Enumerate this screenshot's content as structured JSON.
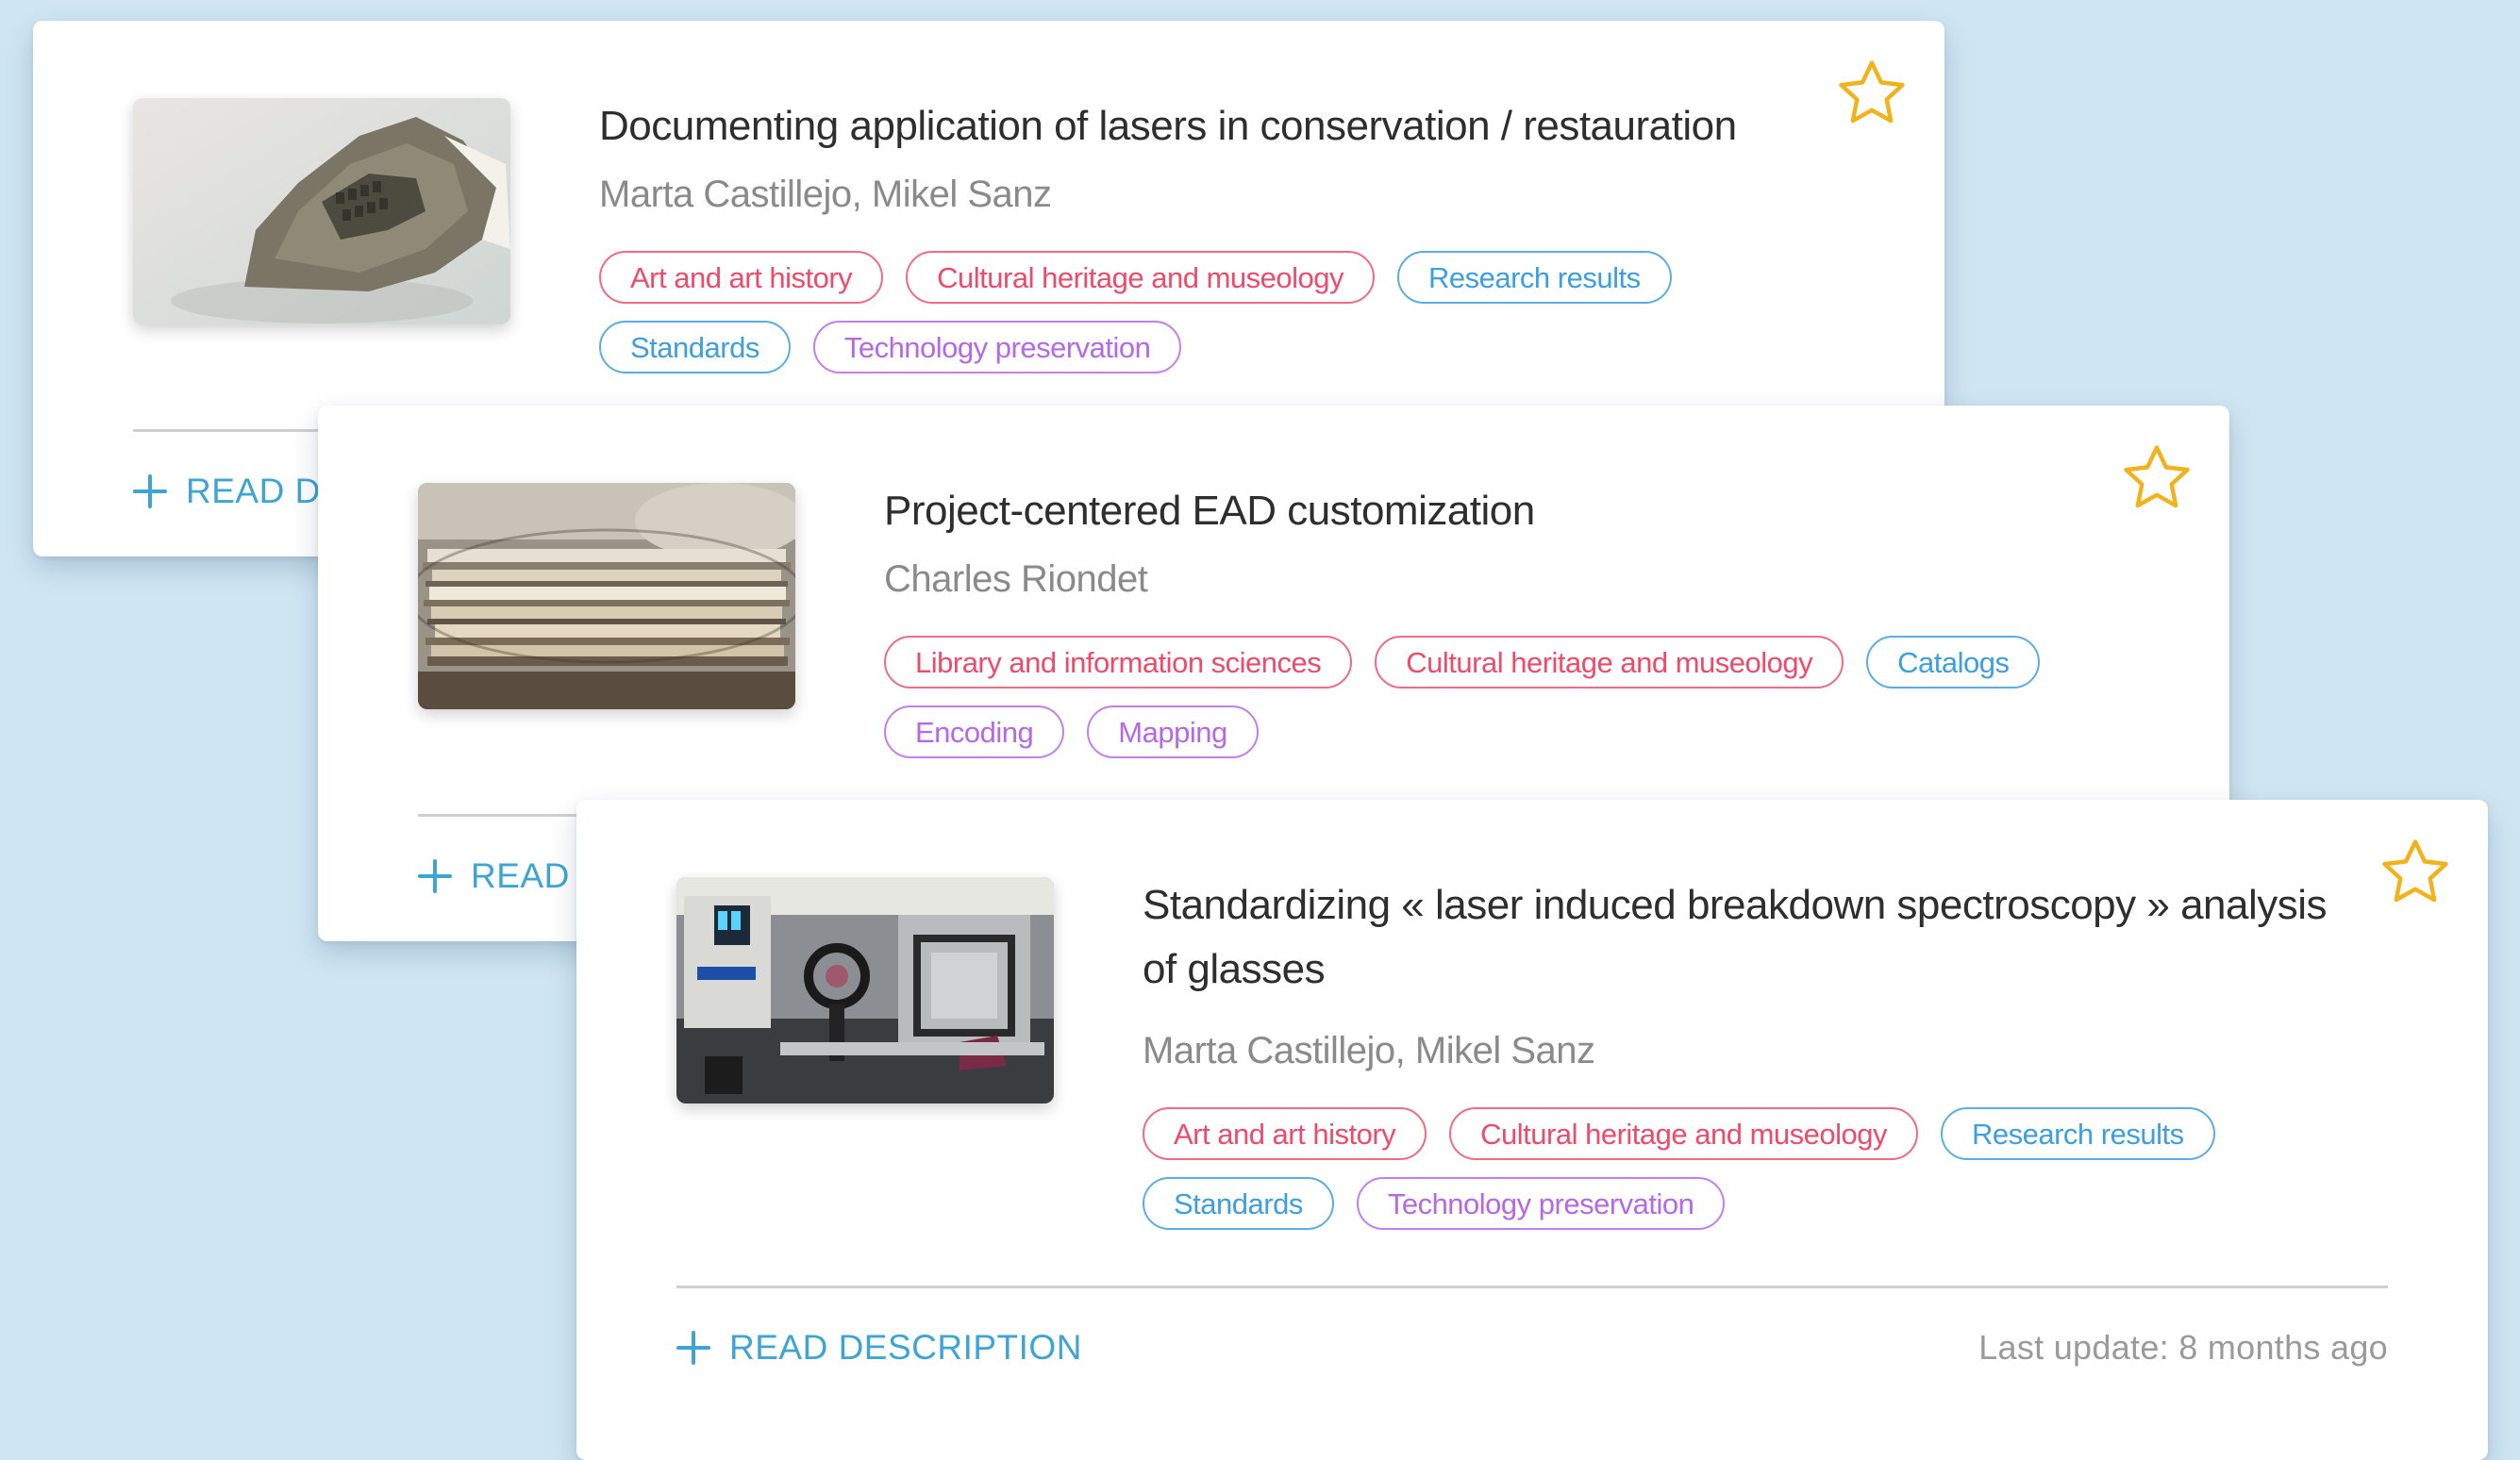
{
  "accent_colors": {
    "red_tag": "#f04a6a",
    "blue_tag": "#3d9fe0",
    "purple_tag": "#b568e8",
    "link": "#3da4d6",
    "star": "#f2b21c",
    "background": "#cfe6f2"
  },
  "cards": [
    {
      "title": "Documenting application of lasers in conservation / restauration",
      "authors": "Marta Castillejo, Mikel Sanz",
      "thumbnail_icon": "stone-fragment-image",
      "favorite_icon": "star-outline-icon",
      "tags": [
        {
          "label": "Art and art history",
          "color": "red"
        },
        {
          "label": "Cultural heritage and museology",
          "color": "red"
        },
        {
          "label": "Research results",
          "color": "blue"
        },
        {
          "label": "Standards",
          "color": "blue"
        },
        {
          "label": "Technology preservation",
          "color": "purple"
        }
      ],
      "read_label": "READ DESCRIPTION",
      "last_update": ""
    },
    {
      "title": "Project-centered EAD customization",
      "authors": "Charles Riondet",
      "thumbnail_icon": "paper-stack-image",
      "favorite_icon": "star-outline-icon",
      "tags": [
        {
          "label": "Library and information sciences",
          "color": "red"
        },
        {
          "label": "Cultural heritage and museology",
          "color": "red"
        },
        {
          "label": "Catalogs",
          "color": "blue"
        },
        {
          "label": "Encoding",
          "color": "purple"
        },
        {
          "label": "Mapping",
          "color": "purple"
        }
      ],
      "read_label": "READ DESCRIPTION",
      "last_update": ""
    },
    {
      "title": "Standardizing « laser induced breakdown spectroscopy » analysis of glasses",
      "authors": "Marta Castillejo, Mikel Sanz",
      "thumbnail_icon": "lab-equipment-image",
      "favorite_icon": "star-outline-icon",
      "tags": [
        {
          "label": "Art and art history",
          "color": "red"
        },
        {
          "label": "Cultural heritage and museology",
          "color": "red"
        },
        {
          "label": "Research results",
          "color": "blue"
        },
        {
          "label": "Standards",
          "color": "blue"
        },
        {
          "label": "Technology preservation",
          "color": "purple"
        }
      ],
      "read_label": "READ DESCRIPTION",
      "last_update": "Last update: 8 months ago"
    }
  ]
}
